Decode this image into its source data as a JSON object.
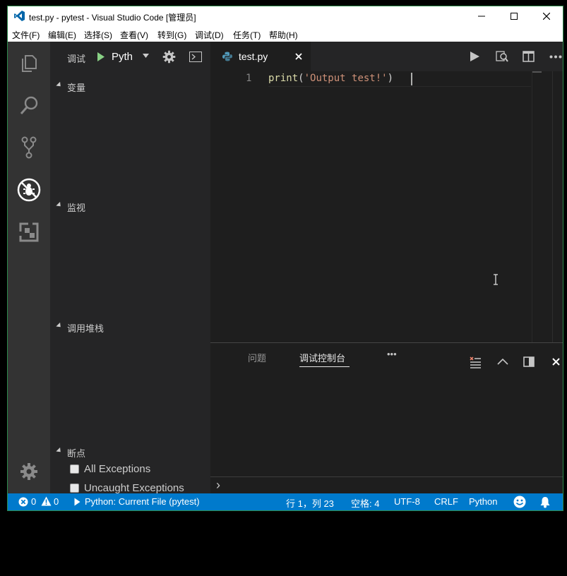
{
  "window": {
    "title": "test.py - pytest - Visual Studio Code [管理员]"
  },
  "menu": [
    "文件(F)",
    "编辑(E)",
    "选择(S)",
    "查看(V)",
    "转到(G)",
    "调试(D)",
    "任务(T)",
    "帮助(H)"
  ],
  "debug_toolbar": {
    "label": "调试",
    "config": "Pyth"
  },
  "sidebar": {
    "sections": {
      "variables": "变量",
      "watch": "监视",
      "call_stack": "调用堆栈",
      "breakpoints": "断点"
    },
    "breakpoints": [
      {
        "label": "All Exceptions",
        "checked": false
      },
      {
        "label": "Uncaught Exceptions",
        "checked": false
      }
    ]
  },
  "editor": {
    "tab_label": "test.py",
    "line_number": "1",
    "code": {
      "fn": "print",
      "open": "(",
      "str": "'Output test!'",
      "close": ")"
    }
  },
  "panel": {
    "tabs": [
      "问题",
      "调试控制台"
    ],
    "active_tab": "调试控制台",
    "more": "•••",
    "prompt": "›"
  },
  "status": {
    "errors": "0",
    "warnings": "0",
    "debug_config": "Python: Current File (pytest)",
    "position": "行 1，列 23",
    "spaces": "空格: 4",
    "encoding": "UTF-8",
    "eol": "CRLF",
    "language": "Python"
  },
  "colors": {
    "accent": "#007acc",
    "activity_bar": "#333333",
    "sidebar": "#252526",
    "editor": "#1e1e1e",
    "run_green": "#89d185",
    "string": "#ce9178",
    "function": "#dcdcaa"
  }
}
